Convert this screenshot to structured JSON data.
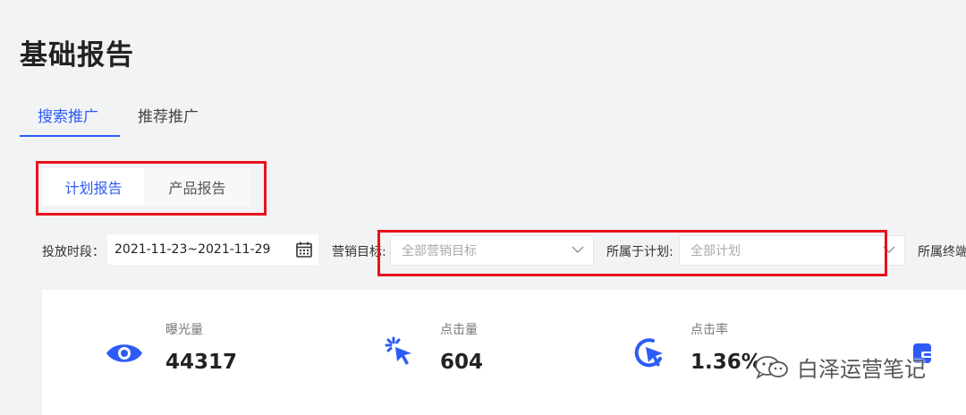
{
  "page": {
    "title": "基础报告"
  },
  "tabs": {
    "search": "搜索推广",
    "recommend": "推荐推广"
  },
  "subtabs": {
    "plan_report": "计划报告",
    "product_report": "产品报告"
  },
  "filters": {
    "date_label": "投放时段：",
    "date_value": "2021-11-23~2021-11-29",
    "goal_label": "营销目标:",
    "goal_placeholder": "全部营销目标",
    "plan_label": "所属于计划:",
    "plan_placeholder": "全部计划",
    "terminal_label": "所属终端"
  },
  "stats": [
    {
      "label": "曝光量",
      "value": "44317",
      "icon": "eye-icon"
    },
    {
      "label": "点击量",
      "value": "604",
      "icon": "click-icon"
    },
    {
      "label": "点击率",
      "value": "1.36%",
      "icon": "click-rate-icon"
    }
  ],
  "watermark": {
    "text": "白泽运营笔记",
    "icon": "wechat-icon"
  },
  "colors": {
    "accent": "#2d5bf6",
    "highlight": "#e8121b",
    "background": "#f2f3f5"
  }
}
